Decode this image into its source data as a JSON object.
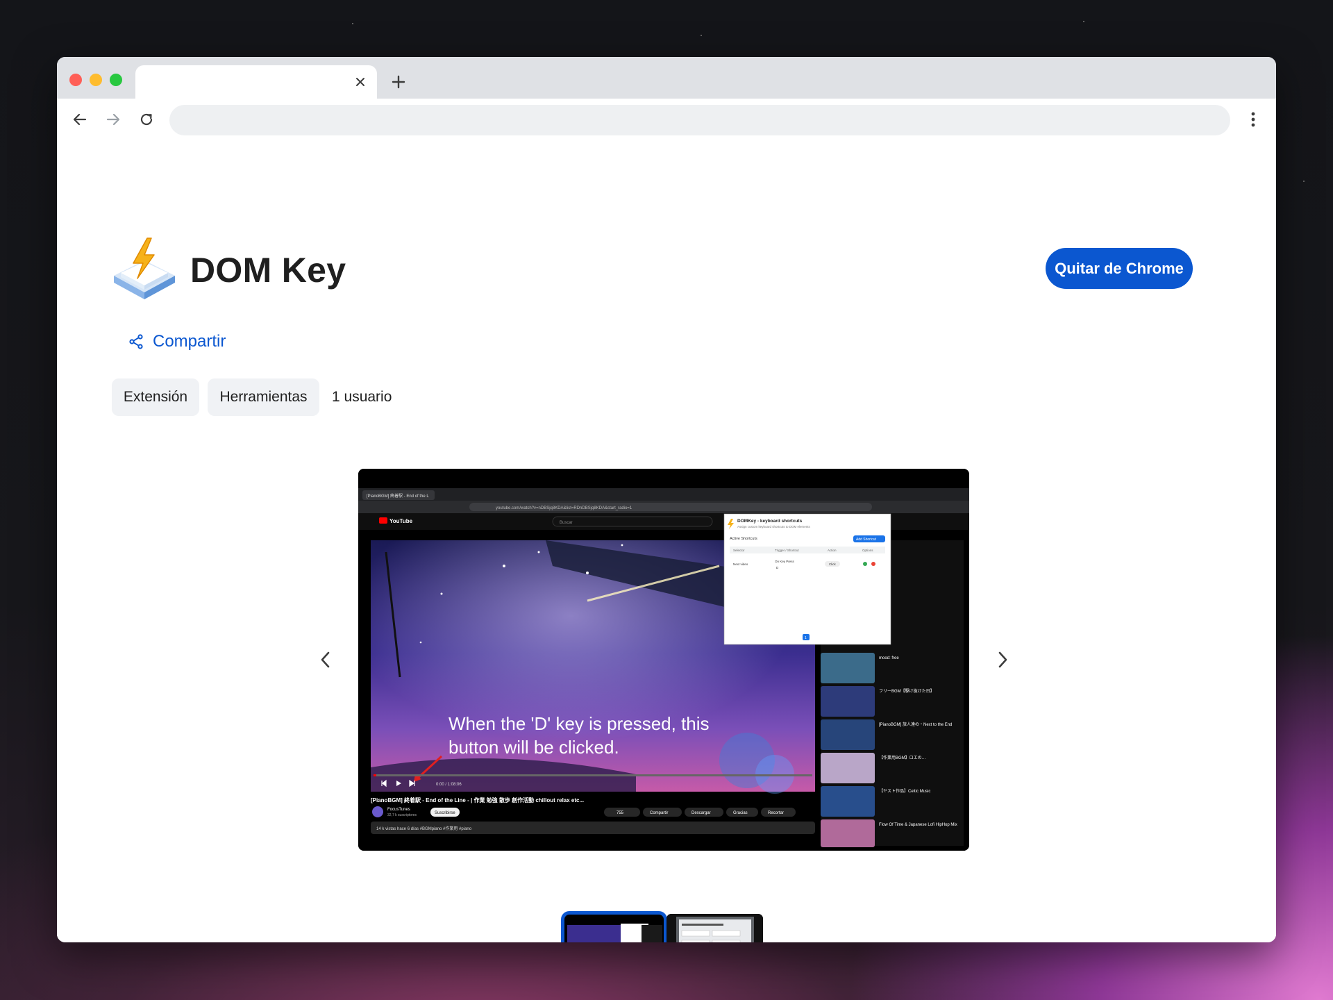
{
  "browser": {
    "tab_title": "",
    "address": "",
    "icons": {
      "tab_close": "close-icon",
      "new_tab": "plus-icon",
      "back": "arrow-left-icon",
      "forward": "arrow-right-icon",
      "reload": "reload-icon",
      "menu": "kebab-menu-icon"
    }
  },
  "extension": {
    "name": "DOM Key",
    "icon": "lightning-key-icon",
    "remove_button": "Quitar de Chrome",
    "share_label": "Compartir",
    "chips": [
      "Extensión",
      "Herramientas"
    ],
    "users": "1 usuario"
  },
  "screenshot": {
    "browser_tab": "[PianoBGM] 終着駅 - End of the L",
    "url": "youtube.com/watch?v=nDBSjq8KDA&list=RDnDBSjq8KDA&start_radio=1",
    "search_placeholder": "Buscar",
    "popup_title": "DOMKey - keyboard shortcuts",
    "popup_subtitle": "Assign custom keyboard shortcuts to DOM elements",
    "popup_section": "Active Shortcuts",
    "popup_add": "Add Shortcut",
    "popup_headers": [
      "Selector",
      "Trigger / Shortcut",
      "Action",
      "Options"
    ],
    "popup_row": {
      "selector": "Next video",
      "trigger": "On Key Press",
      "key": "D",
      "action": "Click"
    },
    "popup_page": "1",
    "overlay_line1": "When the 'D' key is pressed, this",
    "overlay_line2": "button will be clicked.",
    "time": "0:00 / 1:08:06",
    "video_title": "[PianoBGM] 終着駅 - End of the Line - | 作業 勉強 散歩 創作活動 chillout relax etc...",
    "channel": "FocusTunes",
    "subscribers": "32,7 k suscriptores",
    "subscribe": "Suscribirse",
    "likes": "755",
    "share": "Compartir",
    "download": "Descargar",
    "thanks": "Gracias",
    "clip": "Recortar",
    "stats": "14 k vistas  hace 6 días  #BGMpiano #作業用 #piano",
    "sidebar_items": [
      "mood: free",
      "フリーBGM【駆け抜けた日】",
      "[PianoBGM] 旅人達の・Next to the End",
      "【作業用BGM】ロエの…",
      "【ヤスト作品】Celtic Music",
      "Flow Of Time & Japanese Lofi HipHop Mix"
    ]
  }
}
